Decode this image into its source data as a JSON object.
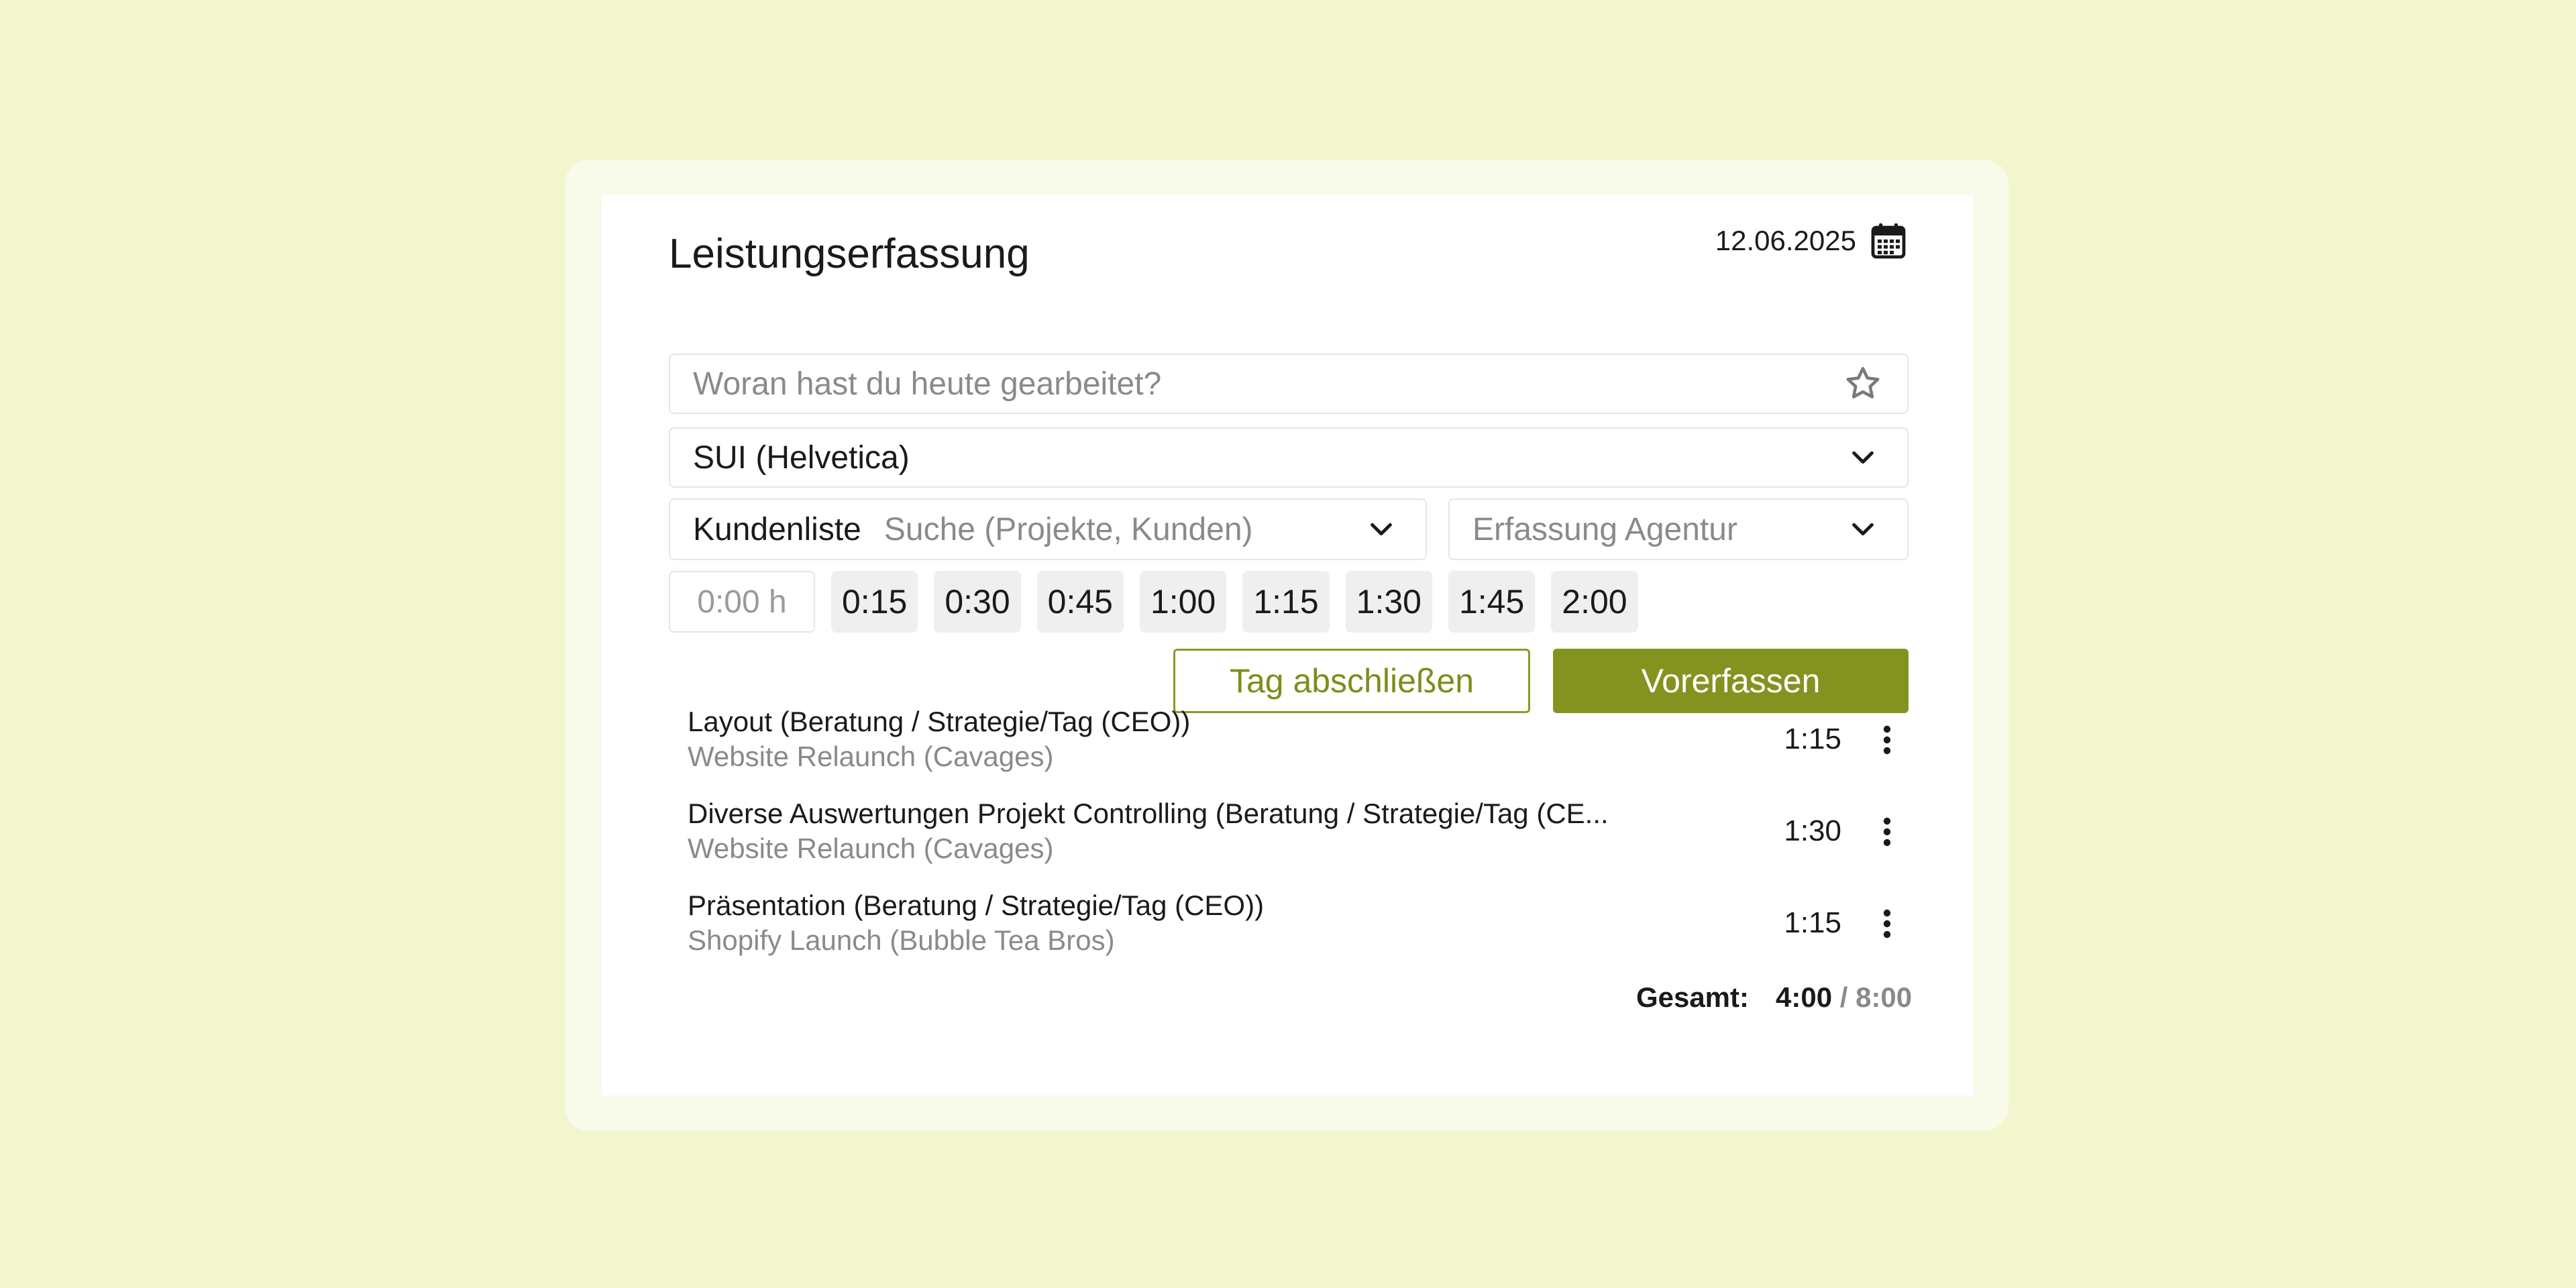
{
  "header": {
    "title": "Leistungserfassung",
    "date": "12.06.2025",
    "calendar_icon": "calendar-icon"
  },
  "description_input": {
    "placeholder": "Woran hast du heute gearbeitet?",
    "icon": "star-icon"
  },
  "font_select": {
    "value": "SUI (Helvetica)",
    "icon": "chevron-down-icon"
  },
  "customer_select": {
    "label": "Kundenliste",
    "placeholder": "Suche (Projekte, Kunden)",
    "icon": "chevron-down-icon"
  },
  "agency_select": {
    "placeholder": "Erfassung Agentur",
    "icon": "chevron-down-icon"
  },
  "duration": {
    "input_placeholder": "0:00 h",
    "presets": [
      "0:15",
      "0:30",
      "0:45",
      "1:00",
      "1:15",
      "1:30",
      "1:45",
      "2:00"
    ]
  },
  "actions": {
    "close_day": "Tag abschließen",
    "prerecord": "Vorerfassen"
  },
  "entries": [
    {
      "name": "Layout (Beratung / Strategie/Tag (CEO))",
      "project": "Website Relaunch (Cavages)",
      "duration": "1:15"
    },
    {
      "name": "Diverse Auswertungen Projekt Controlling (Beratung / Strategie/Tag (CE...",
      "project": "Website Relaunch (Cavages)",
      "duration": "1:30"
    },
    {
      "name": "Präsentation (Beratung / Strategie/Tag (CEO))",
      "project": "Shopify Launch (Bubble Tea Bros)",
      "duration": "1:15"
    }
  ],
  "total": {
    "label": "Gesamt:",
    "current": "4:00",
    "separator": " / ",
    "target": "8:00"
  },
  "colors": {
    "page_background": "#f3f6cc",
    "accent": "#84931f",
    "accent_text": "#7d8e1a"
  }
}
